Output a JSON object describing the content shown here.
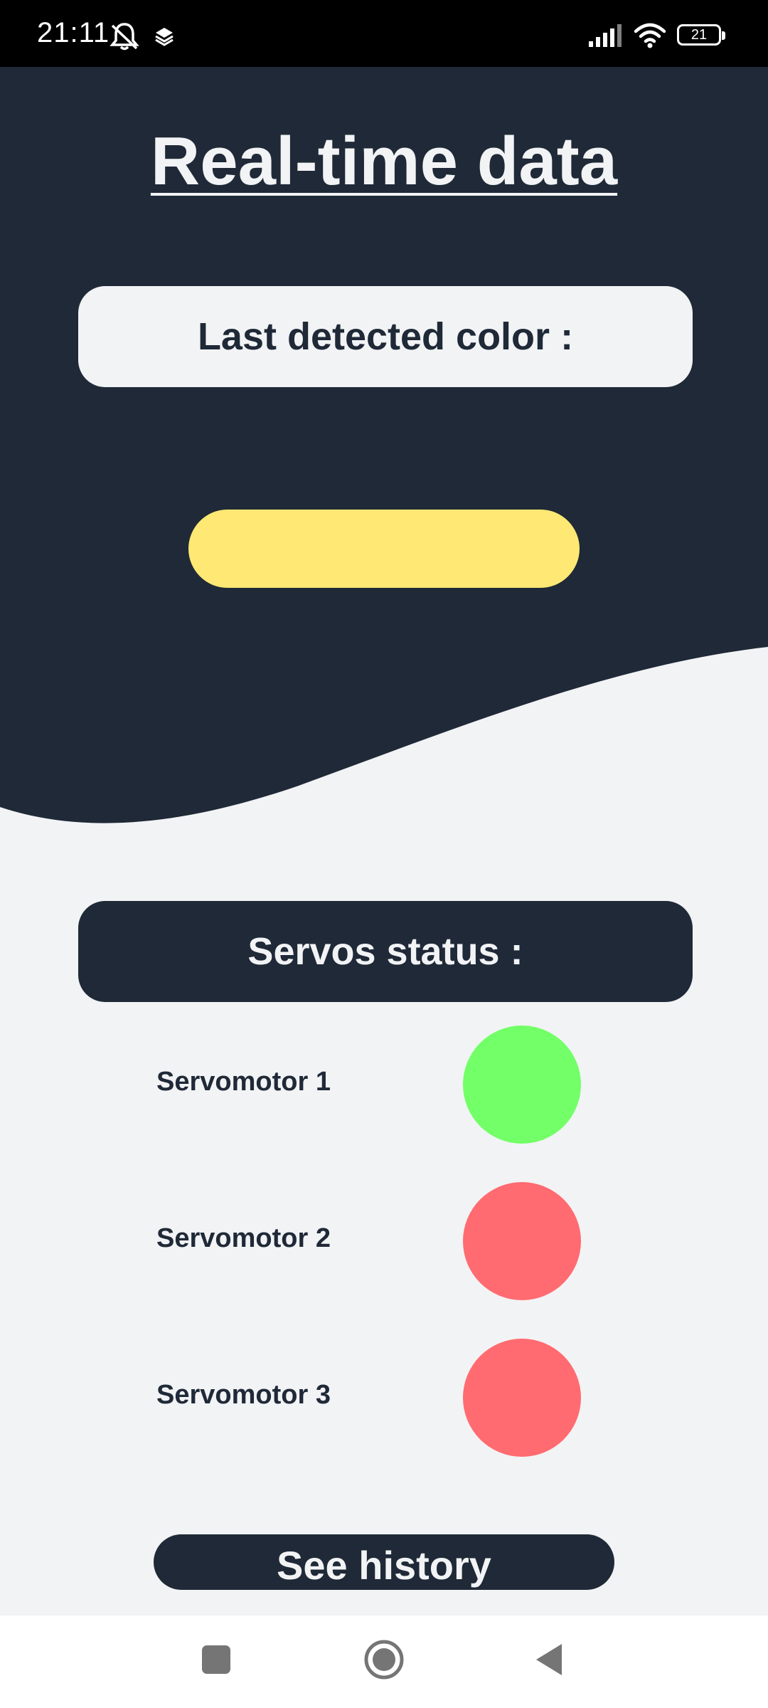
{
  "status_bar": {
    "time": "21:11",
    "battery": "21",
    "icons": [
      "mute-icon",
      "layers-icon",
      "signal-icon",
      "wifi-icon",
      "battery-icon"
    ]
  },
  "header": {
    "title": "Real-time data",
    "background_color": "#1f2937"
  },
  "last_color": {
    "label": "Last detected color :",
    "swatch_color": "#ffe873"
  },
  "servos": {
    "header": "Servos status :",
    "items": [
      {
        "label": "Servomotor 1",
        "color": "#72ff68"
      },
      {
        "label": "Servomotor 2",
        "color": "#ff6b70"
      },
      {
        "label": "Servomotor 3",
        "color": "#ff6b70"
      }
    ]
  },
  "actions": {
    "history_label": "See history"
  },
  "nav_bar": {
    "icons": [
      "recents-square-icon",
      "home-circle-icon",
      "back-triangle-icon"
    ]
  },
  "colors": {
    "dark": "#1f2937",
    "light": "#f2f3f5"
  }
}
